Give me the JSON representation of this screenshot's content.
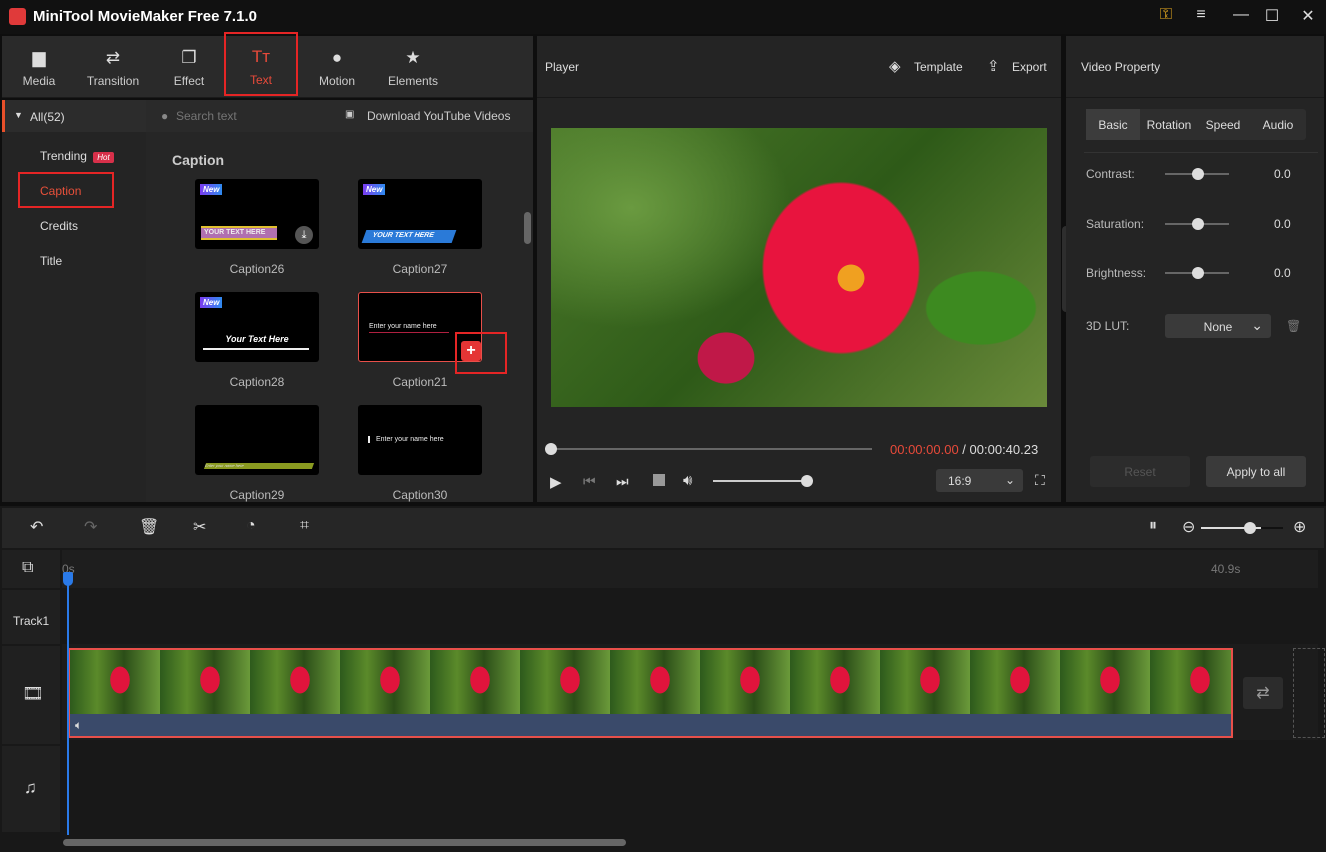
{
  "app": {
    "title": "MiniTool MovieMaker Free 7.1.0",
    "accent": "#e52525"
  },
  "toolbar": [
    {
      "label": "Media",
      "icon": "folder-icon"
    },
    {
      "label": "Transition",
      "icon": "transition-arrows-icon"
    },
    {
      "label": "Effect",
      "icon": "effect-icon"
    },
    {
      "label": "Text",
      "icon": "text-icon",
      "active": true
    },
    {
      "label": "Motion",
      "icon": "motion-icon"
    },
    {
      "label": "Elements",
      "icon": "elements-icon"
    }
  ],
  "sidebar": {
    "all": "All(52)",
    "items": [
      {
        "label": "Trending",
        "badge": "Hot"
      },
      {
        "label": "Caption",
        "active": true
      },
      {
        "label": "Credits"
      },
      {
        "label": "Title"
      }
    ]
  },
  "search": {
    "placeholder": "Search text",
    "download": "Download YouTube Videos"
  },
  "library": {
    "section": "Caption",
    "badge": "New",
    "cards": [
      {
        "name": "Caption26",
        "text": "YOUR TEXT HERE",
        "new": true
      },
      {
        "name": "Caption27",
        "text": "YOUR TEXT HERE",
        "new": true
      },
      {
        "name": "Caption28",
        "text": "Your Text Here",
        "new": true
      },
      {
        "name": "Caption21",
        "text": "Enter your name here"
      },
      {
        "name": "Caption29",
        "text": "Enter your name here"
      },
      {
        "name": "Caption30",
        "text": "Enter your name here"
      }
    ]
  },
  "player": {
    "title": "Player",
    "template": "Template",
    "export": "Export",
    "current": "00:00:00.00",
    "sep": " / ",
    "total": "00:00:40.23",
    "aspect": "16:9",
    "progress": 0,
    "volume": 0.9
  },
  "property": {
    "title": "Video Property",
    "tabs": [
      "Basic",
      "Rotation",
      "Speed",
      "Audio"
    ],
    "active_tab": "Basic",
    "sliders": [
      {
        "label": "Contrast:",
        "value": "0.0"
      },
      {
        "label": "Saturation:",
        "value": "0.0"
      },
      {
        "label": "Brightness:",
        "value": "0.0"
      }
    ],
    "lut_label": "3D LUT:",
    "lut_value": "None",
    "reset": "Reset",
    "apply": "Apply to all"
  },
  "timeline": {
    "start": "0s",
    "end": "40.9s",
    "track1": "Track1",
    "zoom": 0.75
  }
}
